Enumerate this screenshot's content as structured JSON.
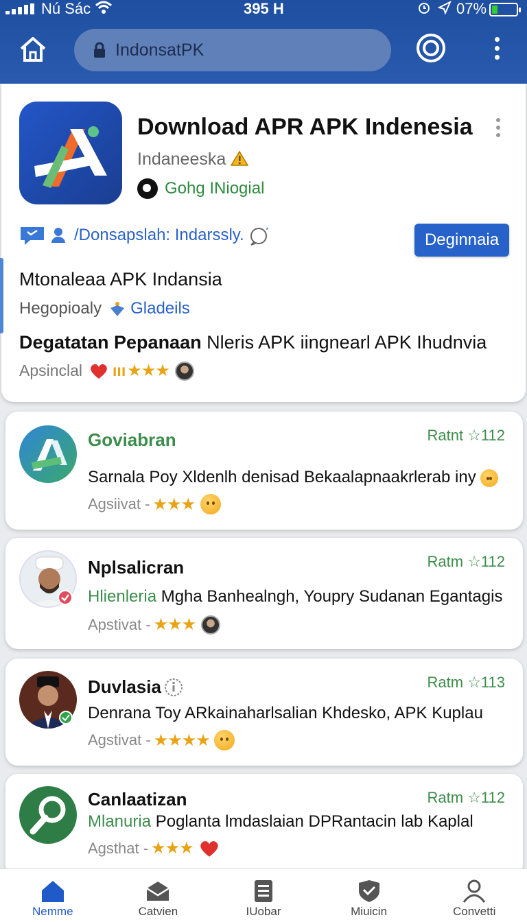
{
  "status_bar": {
    "carrier": "Nú Sác",
    "time": "395 H",
    "battery": "07%"
  },
  "browser": {
    "url": "IndonsatPK"
  },
  "app": {
    "title": "Download APR APK Indenesia",
    "developer": "Indaneeska",
    "verified": "Gohg INiogial",
    "share_text": "/Donsapslah:  Indarssly.",
    "install_label": "Deginnaia",
    "subtitle": "Mtonaleaa APK Indansia",
    "category": "Hegopioaly",
    "category_badge": "Gladeils",
    "desc_bold": "Degatatan Pepanaan",
    "desc_rest": " Nleris APK iingnearl APK Ihudnvia",
    "rating_label": "Apsinclal",
    "rating_marks": "ııı",
    "rating_stars": "★★★"
  },
  "reviews": [
    {
      "name": "Goviabran",
      "score": "Ratnt ☆112",
      "text_hl": "",
      "text": "Sarnala Poy Xldenlh denisad Bekaalapnaakrlerab iny",
      "meta": "Agsiivat -",
      "stars": "★★★"
    },
    {
      "name": "Nplsalicran",
      "score": "Ratm ☆112",
      "text_hl": "Hlienleria",
      "text": " Mgha Banhealngh, Youpry Sudanan Egantagis",
      "meta": "Apstivat -",
      "stars": "★★★"
    },
    {
      "name": "Duvlasia",
      "score": "Ratm ☆113",
      "text_hl": "",
      "text": "Denrana Toy ARkainaharlsalian Khdesko, APK Kuplau",
      "meta": "Agstivat -",
      "stars": "★★★★"
    },
    {
      "name": "Canlaatizan",
      "score": "Ratm ☆112",
      "text_hl": "Mlanuria",
      "text": " Poglanta lmdaslaian DPRantacin lab Kaplal",
      "meta": "Agsthat -",
      "stars": "★★★"
    }
  ],
  "bottom_nav": [
    {
      "label": "Nemme",
      "icon": "home-icon",
      "active": true
    },
    {
      "label": "Catvien",
      "icon": "inbox-icon",
      "active": false
    },
    {
      "label": "IUobar",
      "icon": "document-icon",
      "active": false
    },
    {
      "label": "Miuicin",
      "icon": "shield-icon",
      "active": false
    },
    {
      "label": "Convetti",
      "icon": "person-icon",
      "active": false
    }
  ],
  "colors": {
    "brand": "#2662c9",
    "header": "#1f4fa0",
    "positive": "#3d8d4c",
    "star": "#e8a317"
  }
}
